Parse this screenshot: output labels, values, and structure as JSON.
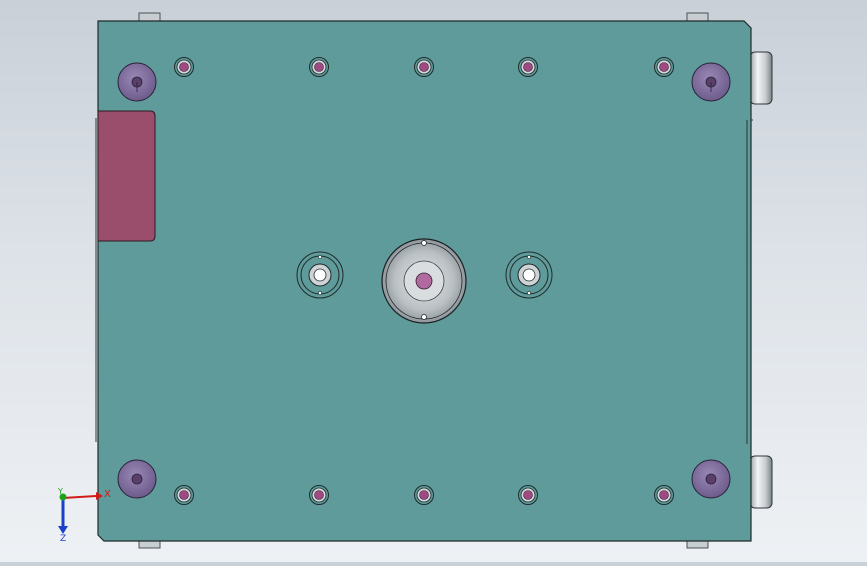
{
  "view": {
    "background_top": "#c9d0d8",
    "background_bottom": "#eef1f4",
    "plate_color": "#5f9b9b",
    "plate_edge": "#1f2a2a",
    "pocket_color": "#9b4e6b",
    "boss_color": "#7c6a9a",
    "bolt_color": "#a04a84",
    "ring_color": "#a8aeb3"
  },
  "triad": {
    "x_label": "X",
    "y_label": "Y",
    "z_label": "Z",
    "x_color": "#d11a1a",
    "y_color": "#1aa31a",
    "z_color": "#1a3fc8"
  },
  "components": {
    "plate": "mold-base-plate",
    "pocket": "side-pocket",
    "bosses": 4,
    "bolt_holes": 10,
    "ejector_rings": 2,
    "sprue_bushing": 1,
    "side_shafts": 2,
    "edge_tabs": 4
  }
}
